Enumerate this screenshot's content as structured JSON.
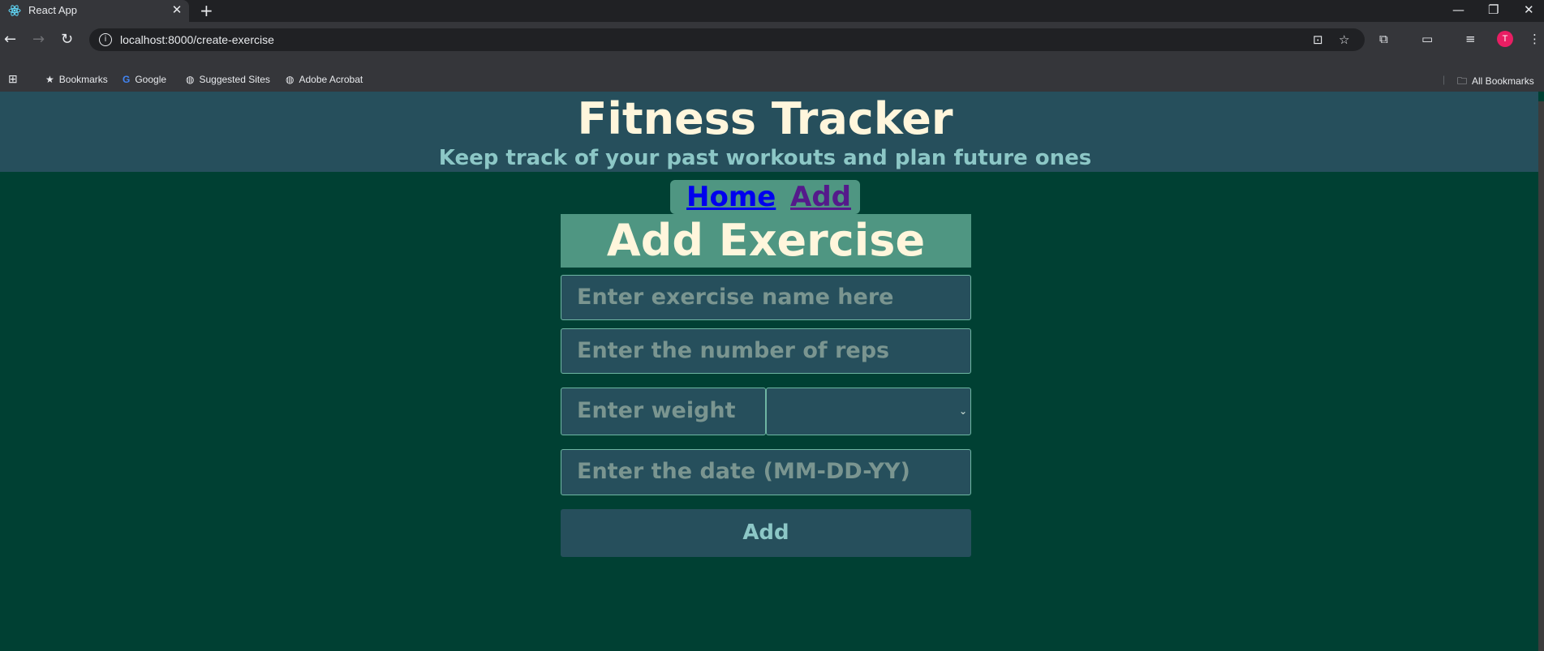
{
  "browser": {
    "tab_title": "React App",
    "url": "localhost:8000/create-exercise",
    "bookmarks": [
      "Bookmarks",
      "Google",
      "Suggested Sites",
      "Adobe Acrobat"
    ],
    "all_bookmarks": "All Bookmarks",
    "profile_initial": "T"
  },
  "header": {
    "title": "Fitness Tracker",
    "subtitle": "Keep track of your past workouts and plan future ones"
  },
  "nav": {
    "home": "Home",
    "add": "Add"
  },
  "form": {
    "title": "Add Exercise",
    "name_placeholder": "Enter exercise name here",
    "reps_placeholder": "Enter the number of reps",
    "weight_placeholder": "Enter weight",
    "unit_value": "",
    "date_placeholder": "Enter the date (MM-DD-YY)",
    "submit_label": "Add"
  },
  "colors": {
    "page_bg": "#004033",
    "header_bg": "#264f5c",
    "accent": "#4f9682",
    "title_text": "#fff6dc",
    "subtitle_text": "#8cc7c6"
  }
}
